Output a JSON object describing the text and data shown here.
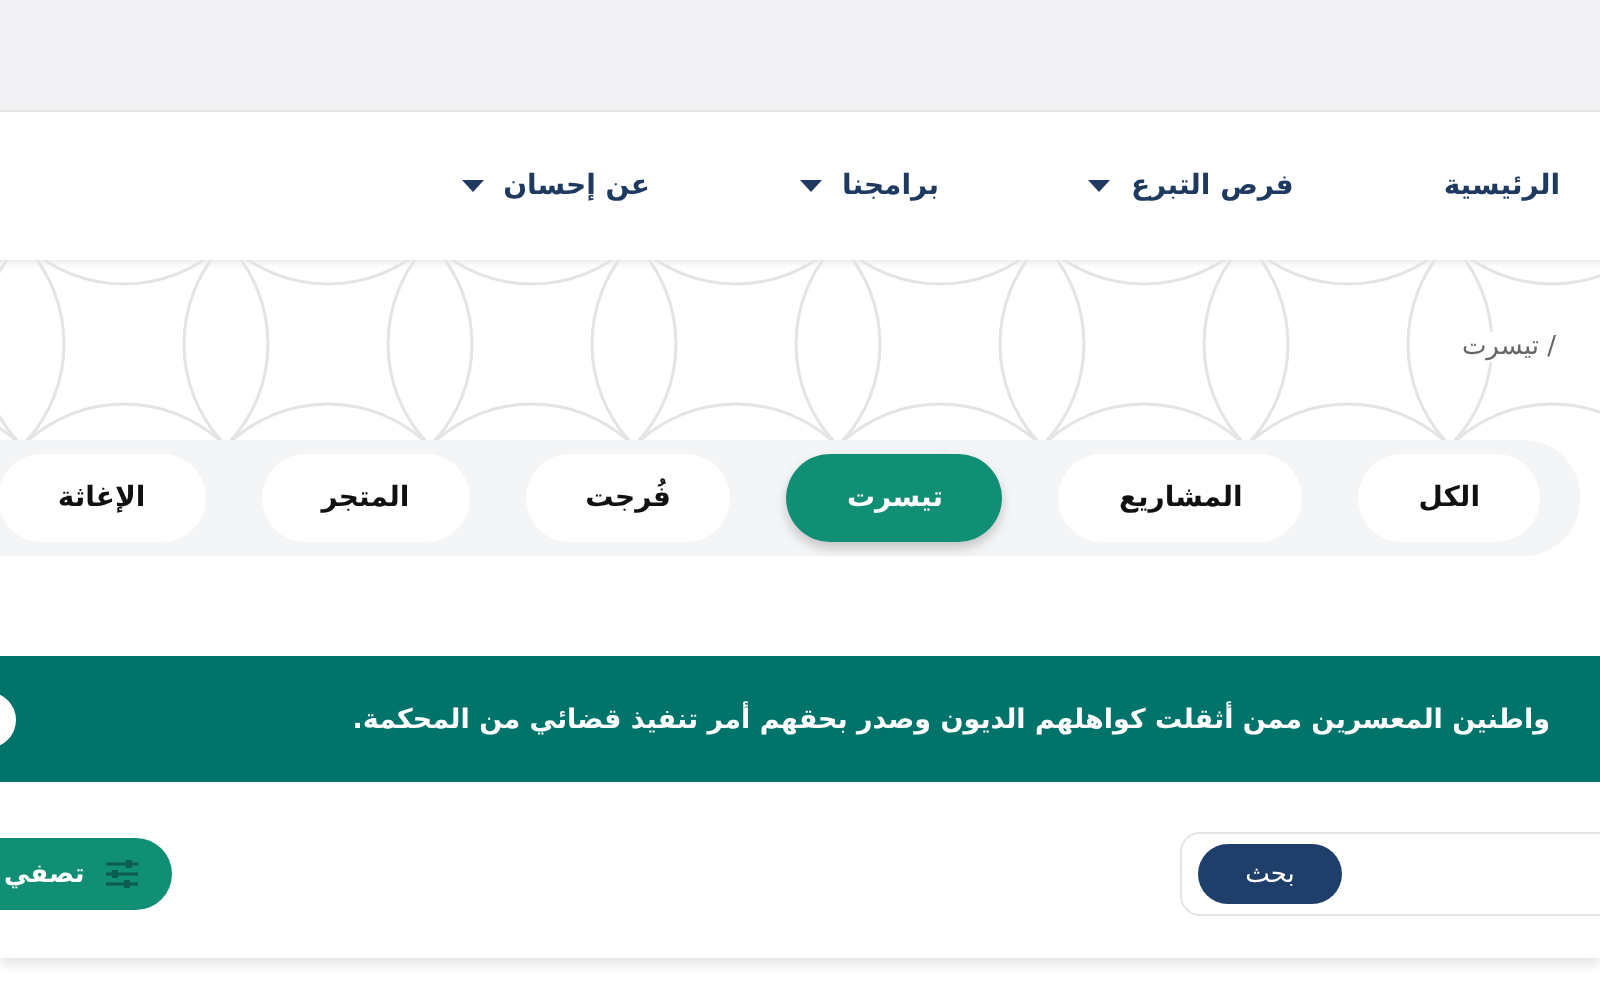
{
  "nav": {
    "items": [
      {
        "label": "الرئيسية",
        "dropdown": false
      },
      {
        "label": "فرص التبرع",
        "dropdown": true
      },
      {
        "label": "برامجنا",
        "dropdown": true
      },
      {
        "label": "عن إحسان",
        "dropdown": true
      }
    ]
  },
  "breadcrumb": {
    "current": "/ تيسرت"
  },
  "tabs": [
    {
      "label": "الكل",
      "selected": false
    },
    {
      "label": "المشاريع",
      "selected": false
    },
    {
      "label": "تيسرت",
      "selected": true
    },
    {
      "label": "فُرجت",
      "selected": false
    },
    {
      "label": "المتجر",
      "selected": false
    },
    {
      "label": "الإغاثة",
      "selected": false
    }
  ],
  "banner": {
    "text": "واطنين المعسرين ممن أثقلت كواهلهم الديون وصدر بحقهم أمر تنفيذ قضائي من المحكمة."
  },
  "search": {
    "button": "بحث"
  },
  "filter": {
    "label": "تصفي"
  }
}
